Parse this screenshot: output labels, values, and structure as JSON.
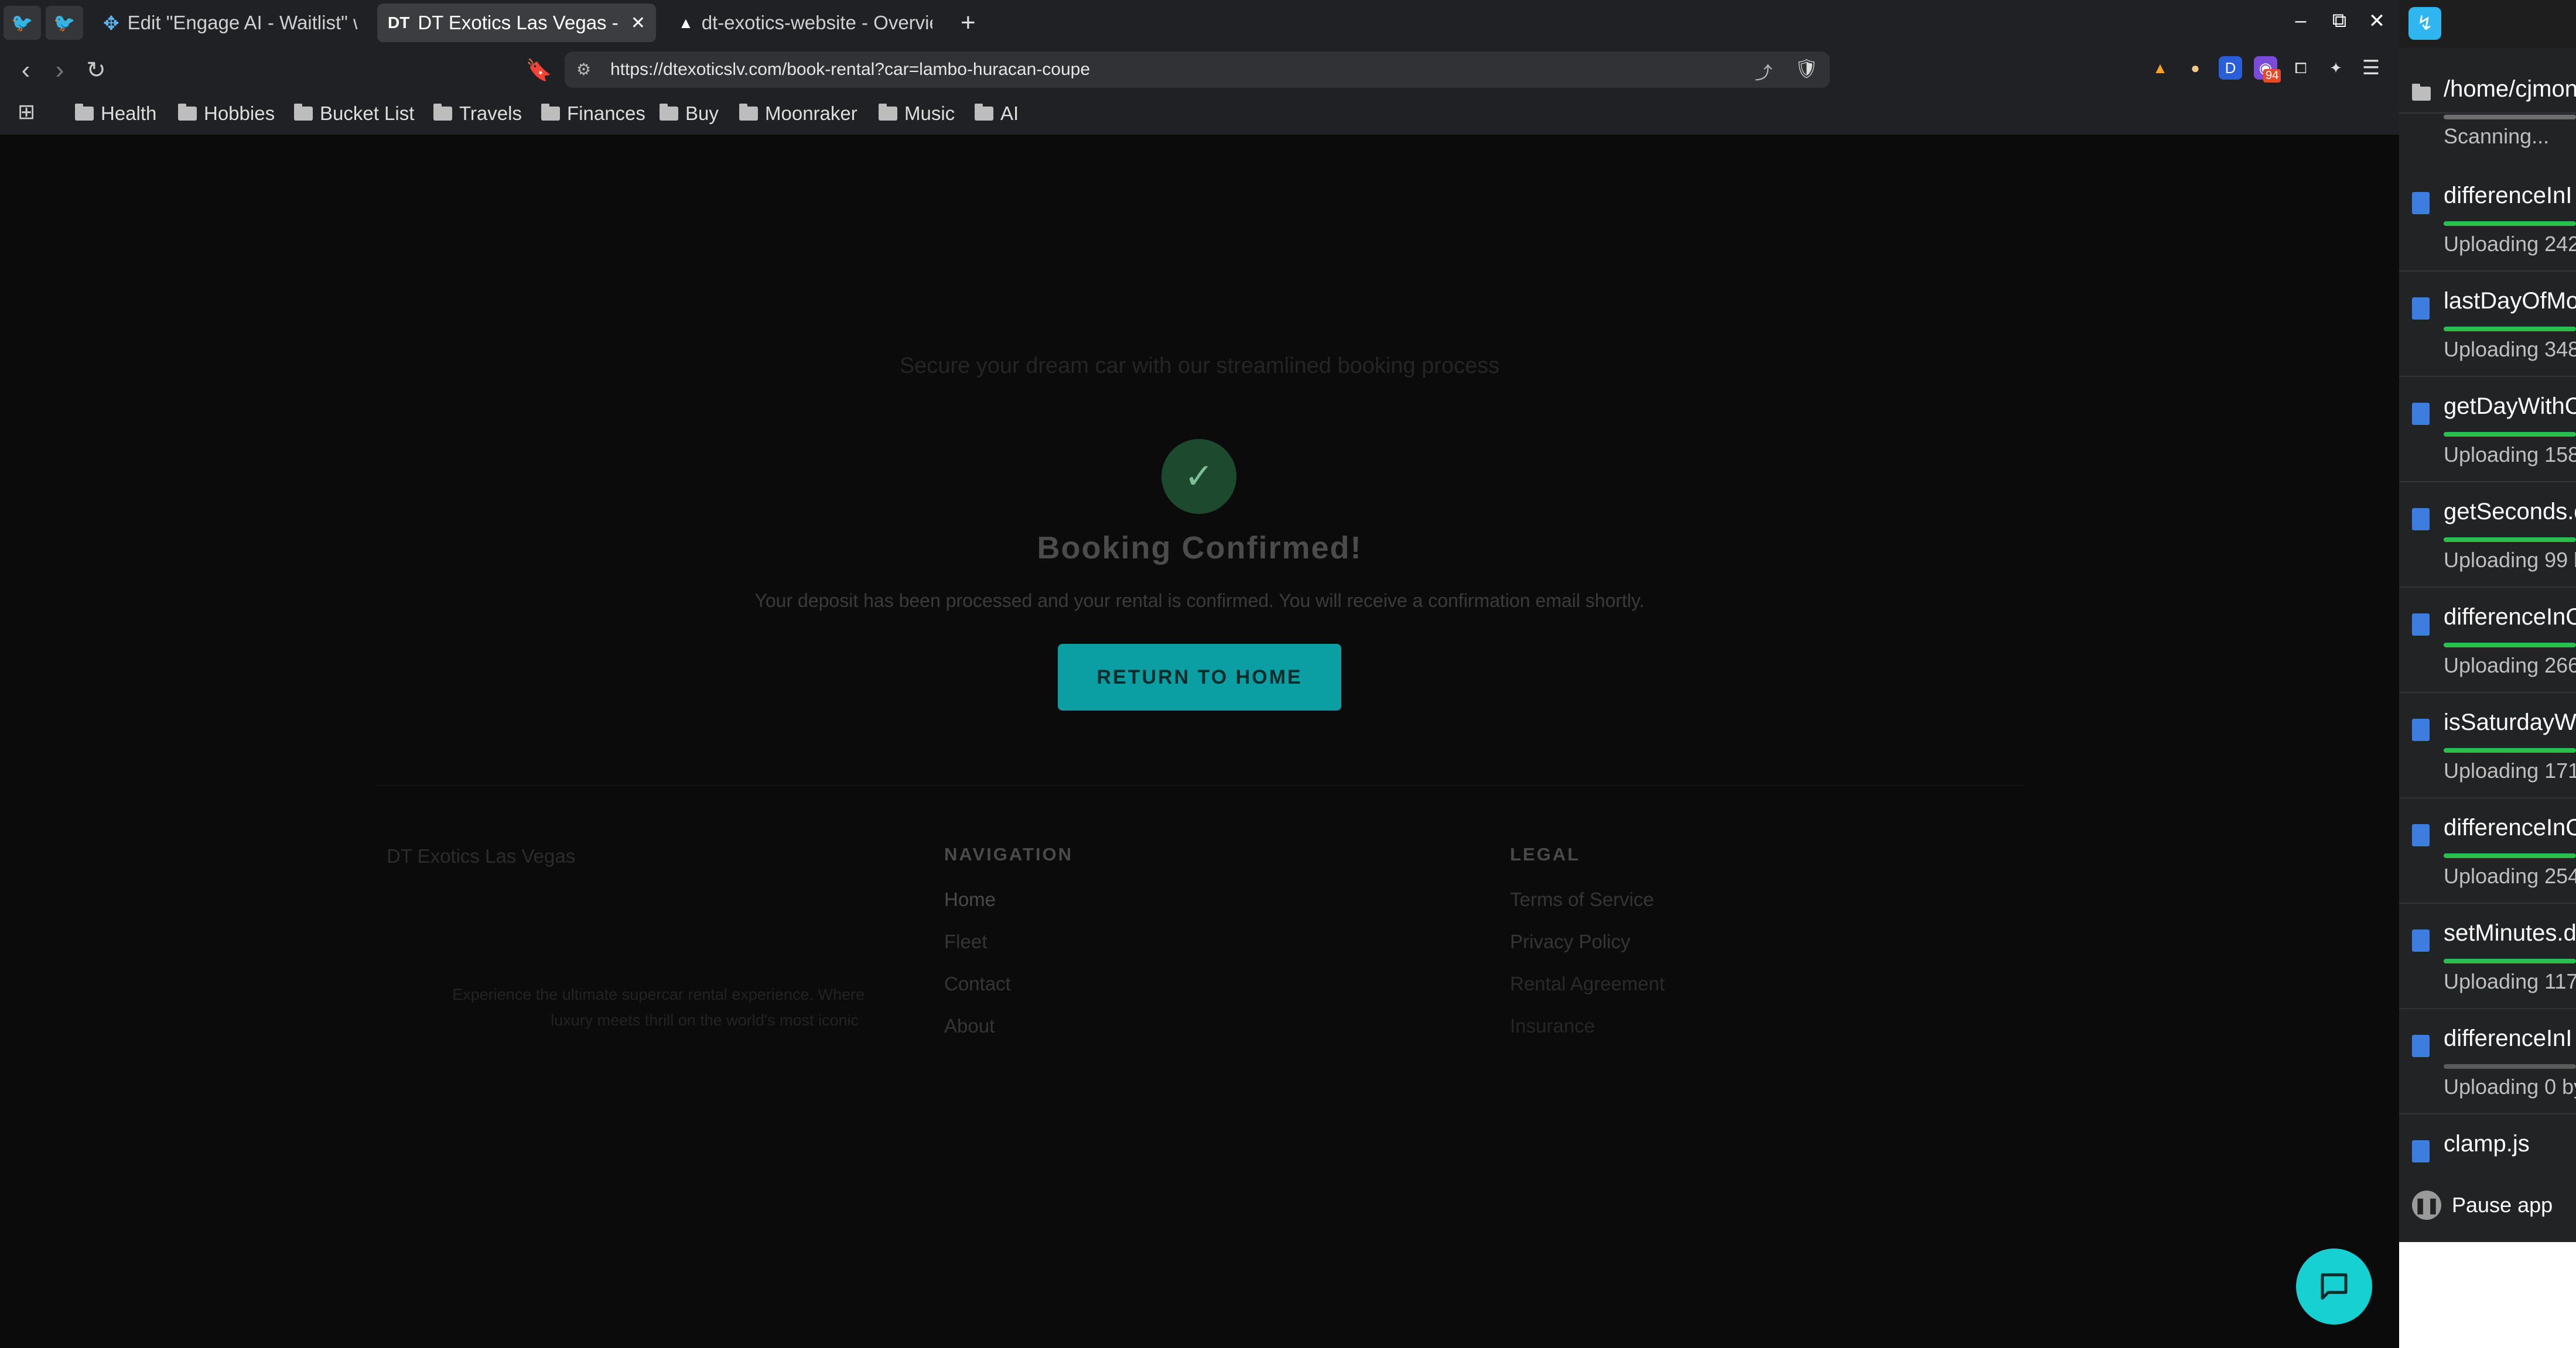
{
  "browser": {
    "tabs": [
      {
        "label": "Edit \"Engage AI - Waitlist\" w",
        "active": false,
        "icon": "sparkle-icon"
      },
      {
        "label": "DT Exotics Las Vegas - P",
        "active": true,
        "icon": "dt-logo-icon"
      },
      {
        "label": "dt-exotics-website - Overvie",
        "active": false,
        "icon": "vercel-triangle-icon"
      }
    ],
    "new_tab": "+",
    "url": "https://dtexoticslv.com/book-rental?car=lambo-huracan-coupe",
    "bookmarks": [
      "Health",
      "Hobbies",
      "Bucket List",
      "Travels",
      "Finances",
      "Buy",
      "Moonraker",
      "Music",
      "AI"
    ],
    "extension_badge": "94"
  },
  "page": {
    "subtitle": "Secure your dream car with our streamlined booking process",
    "confirmation": {
      "title": "Booking Confirmed!",
      "message": "Your deposit has been processed and your rental is confirmed. You will receive a confirmation email shortly.",
      "button": "RETURN TO HOME"
    },
    "footer": {
      "brand": "DT Exotics Las Vegas",
      "tagline_line1": "Experience the ultimate supercar rental experience. Where",
      "tagline_line2": "luxury meets thrill on the world's most iconic",
      "navigation": {
        "heading": "NAVIGATION",
        "links": [
          "Home",
          "Fleet",
          "Contact",
          "About"
        ]
      },
      "legal": {
        "heading": "LEGAL",
        "links": [
          "Terms of Service",
          "Privacy Policy",
          "Rental Agreement",
          "Insurance"
        ]
      }
    }
  },
  "sync_panel": {
    "folder": "/home/cjmon",
    "folder_status": "Scanning...",
    "items": [
      {
        "name": "differenceInI",
        "status": "Uploading 242",
        "progress": "green"
      },
      {
        "name": "lastDayOfMo",
        "status": "Uploading 348",
        "progress": "green"
      },
      {
        "name": "getDayWithC",
        "status": "Uploading 158",
        "progress": "green"
      },
      {
        "name": "getSeconds.d",
        "status": "Uploading 99 b",
        "progress": "green"
      },
      {
        "name": "differenceInC",
        "status": "Uploading 266",
        "progress": "green"
      },
      {
        "name": "isSaturdayW",
        "status": "Uploading 171",
        "progress": "green"
      },
      {
        "name": "differenceInC",
        "status": "Uploading 254",
        "progress": "green"
      },
      {
        "name": "setMinutes.d",
        "status": "Uploading 117",
        "progress": "green"
      },
      {
        "name": "differenceInI",
        "status": "Uploading 0 by",
        "progress": "gray"
      },
      {
        "name": "clamp.js",
        "status": "",
        "progress": "none"
      }
    ],
    "pause_label": "Pause app"
  }
}
